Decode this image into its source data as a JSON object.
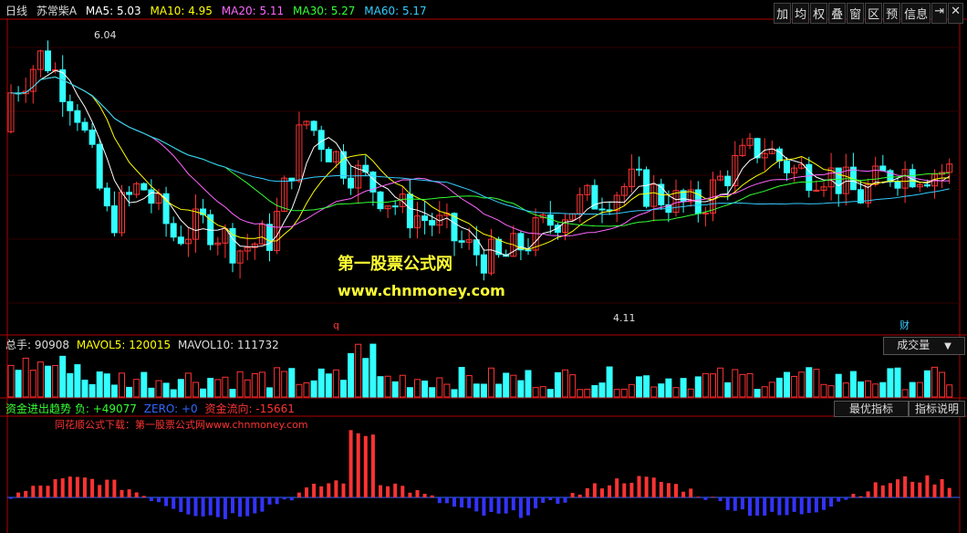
{
  "header": {
    "period": "日线",
    "stock": "苏常柴A",
    "ma": [
      {
        "label": "MA5: 5.03",
        "color": "#ffffff"
      },
      {
        "label": "MA10: 4.95",
        "color": "#ffff00"
      },
      {
        "label": "MA20: 5.11",
        "color": "#ff66ff"
      },
      {
        "label": "MA30: 5.27",
        "color": "#33ff33"
      },
      {
        "label": "MA60: 5.17",
        "color": "#33ccff"
      }
    ]
  },
  "toolbar": [
    "加",
    "均",
    "权",
    "叠",
    "窗",
    "区",
    "预",
    "信息",
    "⇥",
    "✕"
  ],
  "price": {
    "high_label": "6.04",
    "low_label": "4.11",
    "marker_left": "q",
    "marker_right": "财"
  },
  "watermark": {
    "line1": "第一股票公式网",
    "line2": "www.chnmoney.com"
  },
  "volume": {
    "label": "总手: 90908",
    "mavol5": "MAVOL5: 120015",
    "mavol10": "MAVOL10: 111732",
    "selector": "成交量",
    "selector_arrow": "▼"
  },
  "indicator": {
    "name": "资金进出趋势",
    "fu": "负: +49077",
    "zero": "ZERO: +0",
    "flow": "资金流向: -15661",
    "sub": "同花顺公式下载：第一股票公式网www.chnmoney.com",
    "btn_best": "最优指标",
    "btn_help": "指标说明"
  },
  "colors": {
    "up": "#ff3333",
    "down": "#33ffff",
    "grid": "#b00000"
  }
}
